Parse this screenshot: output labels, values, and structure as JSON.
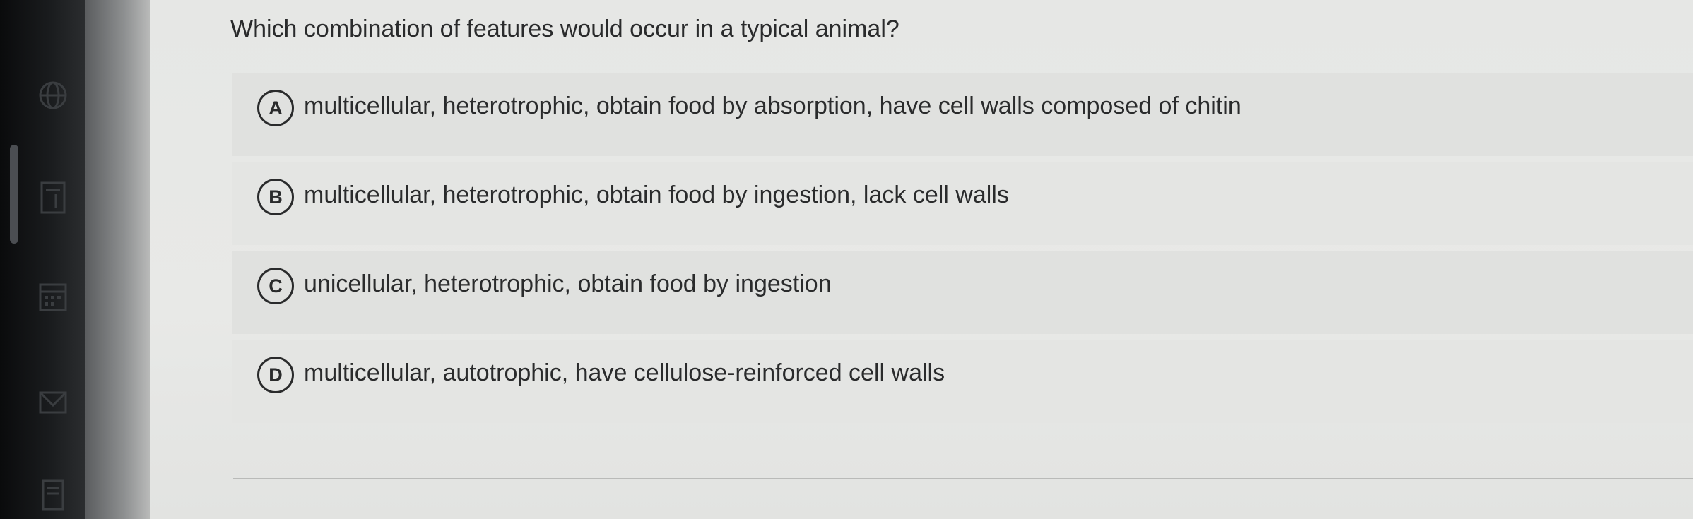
{
  "question": {
    "text": "Which combination of features would occur in a typical animal?"
  },
  "options": [
    {
      "letter": "A",
      "text": "multicellular, heterotrophic, obtain food by absorption, have cell walls composed of chitin"
    },
    {
      "letter": "B",
      "text": "multicellular, heterotrophic, obtain food by ingestion, lack cell walls"
    },
    {
      "letter": "C",
      "text": "unicellular, heterotrophic, obtain food by ingestion"
    },
    {
      "letter": "D",
      "text": "multicellular, autotrophic, have cellulose-reinforced cell walls"
    }
  ],
  "sidebar": {
    "icons": [
      "globe-icon",
      "book-icon",
      "calendar-icon",
      "mail-icon",
      "document-icon"
    ]
  },
  "colors": {
    "text": "#2a2b2c",
    "background": "#e6e7e5",
    "sidebar": "#141618"
  }
}
